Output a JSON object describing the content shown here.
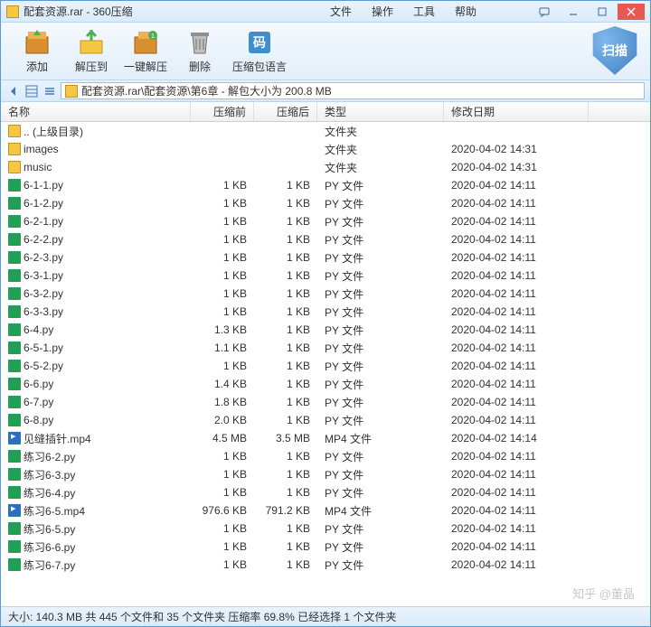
{
  "window": {
    "title": "配套资源.rar - 360压缩"
  },
  "menu": {
    "file": "文件",
    "op": "操作",
    "tool": "工具",
    "help": "帮助"
  },
  "toolbar": {
    "add": "添加",
    "extract": "解压到",
    "oneclick": "一键解压",
    "delete": "删除",
    "compress_lang": "压缩包语言",
    "scan": "扫描"
  },
  "path": "配套资源.rar\\配套资源\\第6章 - 解包大小为 200.8 MB",
  "columns": {
    "name": "名称",
    "before": "压缩前",
    "after": "压缩后",
    "type": "类型",
    "date": "修改日期"
  },
  "files": [
    {
      "icon": "folder",
      "name": ".. (上级目录)",
      "before": "",
      "after": "",
      "type": "文件夹",
      "date": ""
    },
    {
      "icon": "folder",
      "name": "images",
      "before": "",
      "after": "",
      "type": "文件夹",
      "date": "2020-04-02 14:31"
    },
    {
      "icon": "folder",
      "name": "music",
      "before": "",
      "after": "",
      "type": "文件夹",
      "date": "2020-04-02 14:31"
    },
    {
      "icon": "py",
      "name": "6-1-1.py",
      "before": "1 KB",
      "after": "1 KB",
      "type": "PY 文件",
      "date": "2020-04-02 14:11"
    },
    {
      "icon": "py",
      "name": "6-1-2.py",
      "before": "1 KB",
      "after": "1 KB",
      "type": "PY 文件",
      "date": "2020-04-02 14:11"
    },
    {
      "icon": "py",
      "name": "6-2-1.py",
      "before": "1 KB",
      "after": "1 KB",
      "type": "PY 文件",
      "date": "2020-04-02 14:11"
    },
    {
      "icon": "py",
      "name": "6-2-2.py",
      "before": "1 KB",
      "after": "1 KB",
      "type": "PY 文件",
      "date": "2020-04-02 14:11"
    },
    {
      "icon": "py",
      "name": "6-2-3.py",
      "before": "1 KB",
      "after": "1 KB",
      "type": "PY 文件",
      "date": "2020-04-02 14:11"
    },
    {
      "icon": "py",
      "name": "6-3-1.py",
      "before": "1 KB",
      "after": "1 KB",
      "type": "PY 文件",
      "date": "2020-04-02 14:11"
    },
    {
      "icon": "py",
      "name": "6-3-2.py",
      "before": "1 KB",
      "after": "1 KB",
      "type": "PY 文件",
      "date": "2020-04-02 14:11"
    },
    {
      "icon": "py",
      "name": "6-3-3.py",
      "before": "1 KB",
      "after": "1 KB",
      "type": "PY 文件",
      "date": "2020-04-02 14:11"
    },
    {
      "icon": "py",
      "name": "6-4.py",
      "before": "1.3 KB",
      "after": "1 KB",
      "type": "PY 文件",
      "date": "2020-04-02 14:11"
    },
    {
      "icon": "py",
      "name": "6-5-1.py",
      "before": "1.1 KB",
      "after": "1 KB",
      "type": "PY 文件",
      "date": "2020-04-02 14:11"
    },
    {
      "icon": "py",
      "name": "6-5-2.py",
      "before": "1 KB",
      "after": "1 KB",
      "type": "PY 文件",
      "date": "2020-04-02 14:11"
    },
    {
      "icon": "py",
      "name": "6-6.py",
      "before": "1.4 KB",
      "after": "1 KB",
      "type": "PY 文件",
      "date": "2020-04-02 14:11"
    },
    {
      "icon": "py",
      "name": "6-7.py",
      "before": "1.8 KB",
      "after": "1 KB",
      "type": "PY 文件",
      "date": "2020-04-02 14:11"
    },
    {
      "icon": "py",
      "name": "6-8.py",
      "before": "2.0 KB",
      "after": "1 KB",
      "type": "PY 文件",
      "date": "2020-04-02 14:11"
    },
    {
      "icon": "mp4",
      "name": "见缝插针.mp4",
      "before": "4.5 MB",
      "after": "3.5 MB",
      "type": "MP4 文件",
      "date": "2020-04-02 14:14"
    },
    {
      "icon": "py",
      "name": "练习6-2.py",
      "before": "1 KB",
      "after": "1 KB",
      "type": "PY 文件",
      "date": "2020-04-02 14:11"
    },
    {
      "icon": "py",
      "name": "练习6-3.py",
      "before": "1 KB",
      "after": "1 KB",
      "type": "PY 文件",
      "date": "2020-04-02 14:11"
    },
    {
      "icon": "py",
      "name": "练习6-4.py",
      "before": "1 KB",
      "after": "1 KB",
      "type": "PY 文件",
      "date": "2020-04-02 14:11"
    },
    {
      "icon": "mp4",
      "name": "练习6-5.mp4",
      "before": "976.6 KB",
      "after": "791.2 KB",
      "type": "MP4 文件",
      "date": "2020-04-02 14:11"
    },
    {
      "icon": "py",
      "name": "练习6-5.py",
      "before": "1 KB",
      "after": "1 KB",
      "type": "PY 文件",
      "date": "2020-04-02 14:11"
    },
    {
      "icon": "py",
      "name": "练习6-6.py",
      "before": "1 KB",
      "after": "1 KB",
      "type": "PY 文件",
      "date": "2020-04-02 14:11"
    },
    {
      "icon": "py",
      "name": "练习6-7.py",
      "before": "1 KB",
      "after": "1 KB",
      "type": "PY 文件",
      "date": "2020-04-02 14:11"
    }
  ],
  "status": "大小: 140.3 MB 共 445 个文件和 35 个文件夹 压缩率 69.8% 已经选择 1 个文件夹",
  "watermark": "知乎 @董晶"
}
